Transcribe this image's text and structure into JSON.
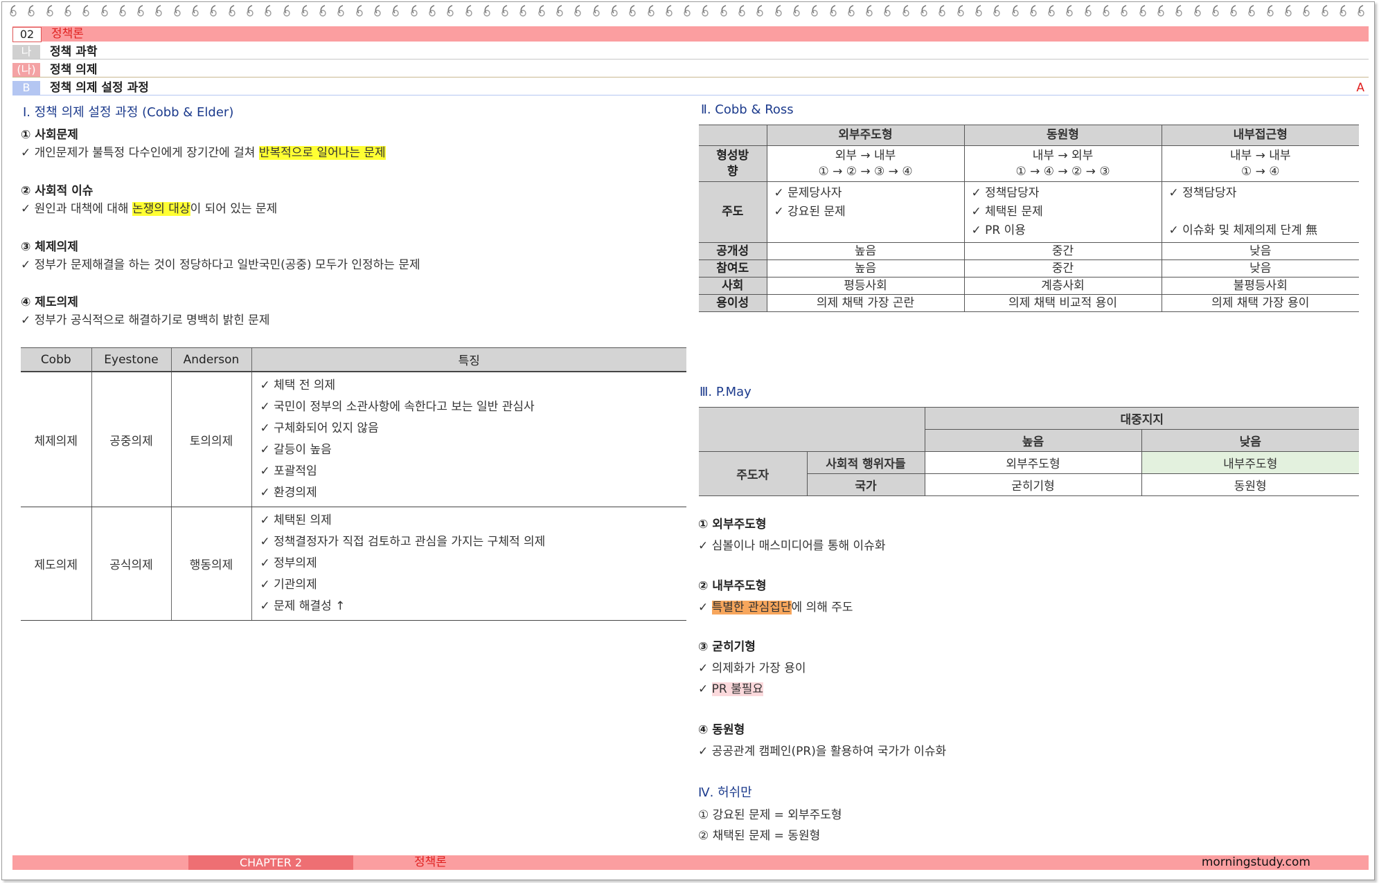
{
  "header": {
    "chapter_num": "02",
    "chapter_title": "정책론",
    "level2_marker": "나",
    "level2_title": "정책 과학",
    "level3_marker": "(나)",
    "level3_title": "정책 의제",
    "level4_marker": "B",
    "level4_title": "정책 의제 설정 과정",
    "grade_mark": "A",
    "colors": {
      "chapter_bar": "#fb9ea0",
      "level2": "#d0d0d0",
      "level3": "#f4a2a4",
      "level4": "#b4c6f2",
      "section_title": "#1b3a8c"
    }
  },
  "left": {
    "section_title": "Ⅰ. 정책 의제 설정 과정 (Cobb & Elder)",
    "items": [
      {
        "title": "① 사회문제",
        "pre": "✓ 개인문제가 불특정 다수인에게 장기간에 걸쳐 ",
        "hl": "반복적으로 일어나는 문제",
        "post": ""
      },
      {
        "title": "② 사회적 이슈",
        "pre": "✓ 원인과 대책에 대해 ",
        "hl": "논쟁의 대상",
        "post": "이 되어 있는 문제"
      },
      {
        "title": "③ 체제의제",
        "pre": "✓ 정부가 문제해결을 하는 것이 정당하다고 일반국민(공중) 모두가 인정하는 문제",
        "hl": "",
        "post": ""
      },
      {
        "title": "④ 제도의제",
        "pre": "✓ 정부가 공식적으로 해결하기로 명백히 밝힌 문제",
        "hl": "",
        "post": ""
      }
    ],
    "table": {
      "headers": [
        "Cobb",
        "Eyestone",
        "Anderson",
        "특징"
      ],
      "rows": [
        {
          "cobb": "체제의제",
          "eyestone": "공중의제",
          "anderson": "토의의제",
          "features": [
            "✓ 체택 전 의제",
            "✓ 국민이 정부의 소관사항에 속한다고 보는 일반 관심사",
            "✓ 구체화되어 있지 않음",
            "✓ 갈등이 높음",
            "✓ 포괄적임",
            "✓ 환경의제"
          ]
        },
        {
          "cobb": "제도의제",
          "eyestone": "공식의제",
          "anderson": "행동의제",
          "features": [
            "✓ 체택된 의제",
            "✓ 정책결정자가 직접 검토하고 관심을 가지는 구체적 의제",
            "✓ 정부의제",
            "✓ 기관의제",
            "✓ 문제 해결성 ↑"
          ]
        }
      ]
    }
  },
  "right": {
    "cobb_ross": {
      "section_title": "Ⅱ. Cobb & Ross",
      "headers": [
        "",
        "외부주도형",
        "동원형",
        "내부접근형"
      ],
      "flow_label_1": "형성방",
      "flow_label_2": "향",
      "flow_dir": [
        "외부 → 내부",
        "내부 → 외부",
        "내부 → 내부"
      ],
      "flow_steps": [
        "① → ② → ③ → ④",
        "① → ④ → ② → ③",
        "① → ④"
      ],
      "lead_label": "주도",
      "lead": [
        [
          "✓ 문제당사자",
          "✓ 강요된 문제"
        ],
        [
          "✓ 정책담당자",
          "✓ 체택된 문제",
          "✓ PR 이용"
        ],
        [
          "✓ 정책담당자",
          "✓ 이슈화 및 체제의제 단계 無"
        ]
      ],
      "rows": [
        {
          "label": "공개성",
          "values": [
            "높음",
            "중간",
            "낮음"
          ]
        },
        {
          "label": "참여도",
          "values": [
            "높음",
            "중간",
            "낮음"
          ]
        },
        {
          "label": "사회",
          "values": [
            "평등사회",
            "계층사회",
            "불평등사회"
          ]
        },
        {
          "label": "용이성",
          "values": [
            "의제 채택 가장 곤란",
            "의제 채택 비교적 용이",
            "의제 채택 가장 용이"
          ]
        }
      ]
    },
    "pmay": {
      "section_title": "Ⅲ. P.May",
      "support_header": "대중지지",
      "high": "높음",
      "low": "낮음",
      "actor_label": "주도자",
      "social_actor": "사회적 행위자들",
      "state": "국가",
      "cells": {
        "social_high": "외부주도형",
        "social_low": "내부주도형",
        "state_high": "굳히기형",
        "state_low": "동원형"
      },
      "items": [
        {
          "title": "① 외부주도형",
          "lines": [
            {
              "pre": "✓ 심볼이나 매스미디어를 통해 이슈화",
              "hl": "",
              "post": ""
            }
          ]
        },
        {
          "title": "② 내부주도형",
          "lines": [
            {
              "pre": "✓ ",
              "hl": "특별한 관심집단",
              "post": "에 의해 주도"
            }
          ]
        },
        {
          "title": "③ 굳히기형",
          "lines": [
            {
              "pre": "✓ 의제화가 가장 용이",
              "hl": "",
              "post": ""
            },
            {
              "pre": "✓ ",
              "hl": "PR 불필요",
              "post": ""
            }
          ]
        },
        {
          "title": "④ 동원형",
          "lines": [
            {
              "pre": "✓ 공공관계 캠페인(PR)을 활용하여 국가가 이슈화",
              "hl": "",
              "post": ""
            }
          ]
        }
      ]
    },
    "hershman": {
      "section_title": "Ⅳ. 허쉬만",
      "lines": [
        "① 강요된 문제 = 외부주도형",
        "② 채택된 문제 = 동원형"
      ]
    }
  },
  "footer": {
    "chapter": "CHAPTER 2",
    "title": "정책론",
    "site": "morningstudy.com"
  }
}
